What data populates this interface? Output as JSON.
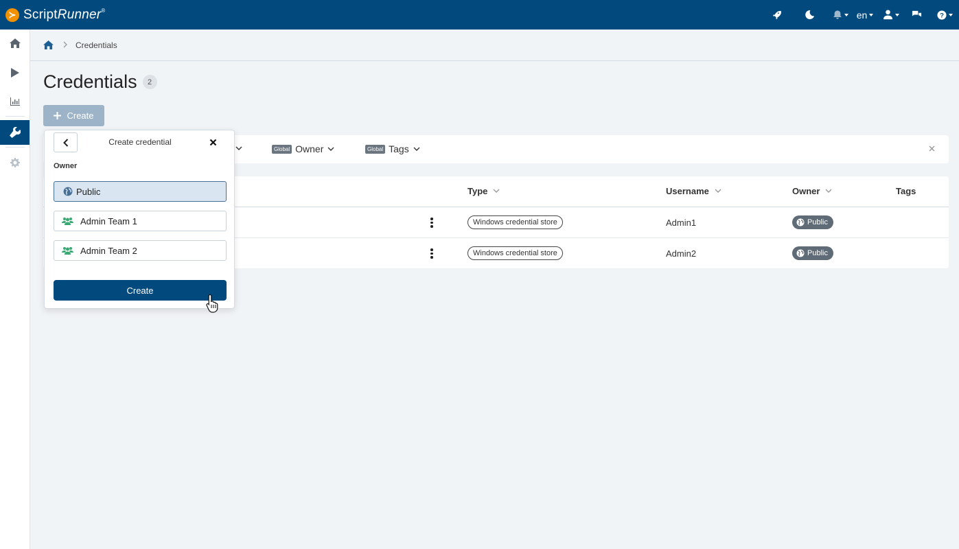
{
  "app": {
    "logo_mark": "≻",
    "logo_script": "Script",
    "logo_runner": "Runner",
    "logo_reg": "®"
  },
  "topbar": {
    "icons": [
      "rocket-icon",
      "moon-icon",
      "bell-icon",
      "user-icon",
      "chat-icon",
      "help-icon"
    ],
    "language": "en"
  },
  "sidebar": {
    "items": [
      "home-icon",
      "play-icon",
      "chart-icon",
      "wrench-icon",
      "gear-icon"
    ],
    "active": "wrench-icon"
  },
  "breadcrumb": {
    "current": "Credentials"
  },
  "page": {
    "title": "Credentials",
    "count": "2",
    "create_label": "Create"
  },
  "filters": [
    {
      "tag": "Global",
      "label": "Owner"
    },
    {
      "tag": "Global",
      "label": "Tags"
    }
  ],
  "table": {
    "columns": [
      "Type",
      "Username",
      "Owner",
      "Tags"
    ],
    "rows": [
      {
        "type": "Windows credential store",
        "username": "Admin1",
        "owner": "Public"
      },
      {
        "type": "Windows credential store",
        "username": "Admin2",
        "owner": "Public"
      }
    ]
  },
  "popup": {
    "title": "Create credential",
    "owner_label": "Owner",
    "options": [
      "Public",
      "Admin Team 1",
      "Admin Team 2"
    ],
    "selected": "Public",
    "create_label": "Create"
  },
  "colors": {
    "brand": "#024a7d",
    "accent": "#f39200",
    "team_icon": "#3aa873"
  }
}
